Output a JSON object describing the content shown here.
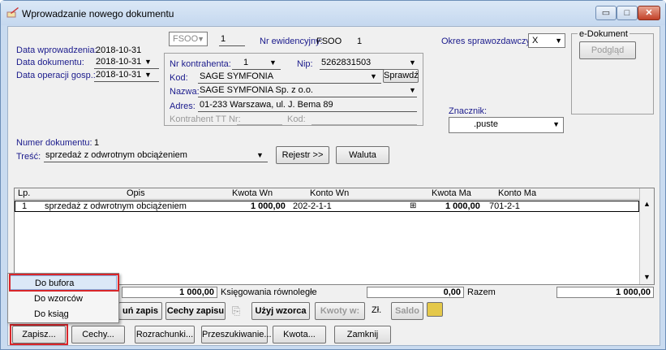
{
  "window": {
    "title": "Wprowadzanie nowego dokumentu",
    "min_glyph": "▭",
    "max_glyph": "□",
    "close_glyph": "✕"
  },
  "header": {
    "data_wprowadzenia_label": "Data wprowadzenia:",
    "data_wprowadzenia": "2018-10-31",
    "data_dokumentu_label": "Data dokumentu:",
    "data_dokumentu": "2018-10-31",
    "data_operacji_label": "Data operacji gosp.:",
    "data_operacji": "2018-10-31",
    "typ": "FSOO",
    "typ_nr": "1",
    "nr_ewid_label": "Nr ewidencyjny:",
    "nr_ewid": "FSOO",
    "nr_ewid_num": "1",
    "okres_label": "Okres sprawozdawczy:",
    "okres": "X",
    "edok_label": "e-Dokument",
    "podglad": "Podgląd",
    "nr_kontrahenta_label": "Nr kontrahenta:",
    "nr_kontrahenta": "1",
    "nip_label": "Nip:",
    "nip": "5262831503",
    "kod_label": "Kod:",
    "kod": "SAGE SYMFONIA",
    "sprawdz": "Sprawdź",
    "nazwa_label": "Nazwa:",
    "nazwa": "SAGE SYMFONIA Sp. z o.o.",
    "adres_label": "Adres:",
    "adres": "01-233 Warszawa, ul. J. Bema 89",
    "kontrahent_tt_label": "Kontrahent TT Nr:",
    "kod2_label": "Kod:",
    "znacznik_label": "Znacznik:",
    "znacznik": ".puste",
    "numer_label": "Numer dokumentu:",
    "numer": "1",
    "tresc_label": "Treść:",
    "tresc": "sprzedaż z odwrotnym obciążeniem",
    "rejestr": "Rejestr >>",
    "waluta": "Waluta"
  },
  "grid": {
    "headers": [
      "Lp.",
      "Opis",
      "Kwota Wn",
      "Konto Wn",
      "Kwota Ma",
      "Konto Ma"
    ],
    "rows": [
      {
        "lp": "1",
        "opis": "sprzedaż z odwrotnym obciążeniem",
        "kwota_wn": "1 000,00",
        "konto_wn": "202-2-1-1",
        "kwota_ma": "1 000,00",
        "konto_ma": "701-2-1"
      }
    ]
  },
  "totals": {
    "wn": "1 000,00",
    "ksieg_label": "Księgowania równoległe",
    "ma": "0,00",
    "razem_label": "Razem",
    "razem": "1 000,00"
  },
  "actions": {
    "usun": "uń zapis",
    "cechy_zapisu": "Cechy zapisu",
    "uzyj_wzorca": "Użyj wzorca",
    "kwoty_w": "Kwoty w:",
    "zl": "Zł.",
    "saldo": "Saldo"
  },
  "footer": {
    "zapisz": "Zapisz...",
    "cechy": "Cechy...",
    "rozrachunki": "Rozrachunki...",
    "przeszukiwanie": "Przeszukiwanie...",
    "kwota": "Kwota...",
    "zamknij": "Zamknij"
  },
  "menu": {
    "items": [
      "Do bufora",
      "Do wzorców",
      "Do ksiąg"
    ]
  },
  "colors": {
    "highlight": "#d9262a",
    "menu_selected": "#dbe8f7"
  }
}
